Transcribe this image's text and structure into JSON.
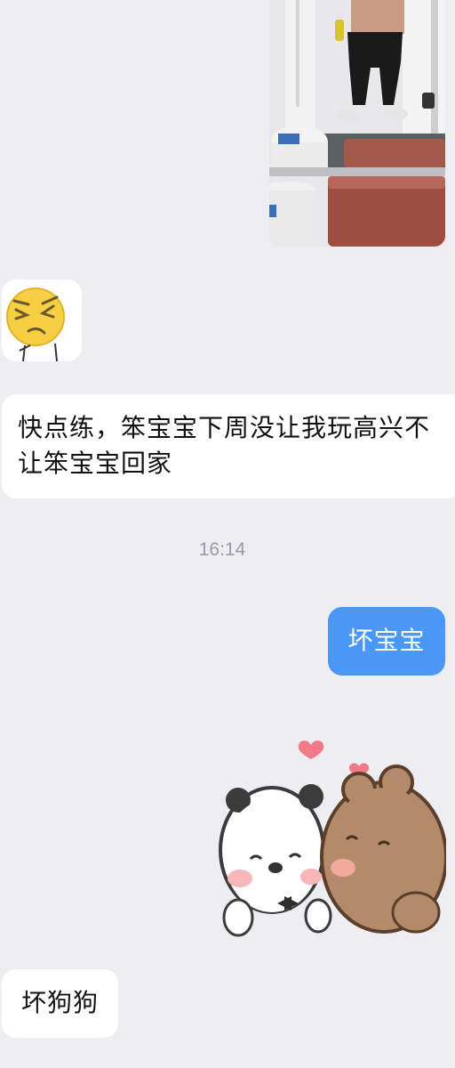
{
  "messages": {
    "long_text": "快点练，笨宝宝下周没让我玩高兴不让笨宝宝回家",
    "timestamp": "16:14",
    "bad_baby": "坏宝宝",
    "bad_dog": "坏狗狗"
  },
  "colors": {
    "background": "#ededf2",
    "incoming_bubble": "#ffffff",
    "outgoing_bubble": "#4a97f5"
  },
  "stickers": {
    "emoji": "grimacing-face-sticker",
    "bears": "panda-and-bear-kiss-sticker"
  }
}
